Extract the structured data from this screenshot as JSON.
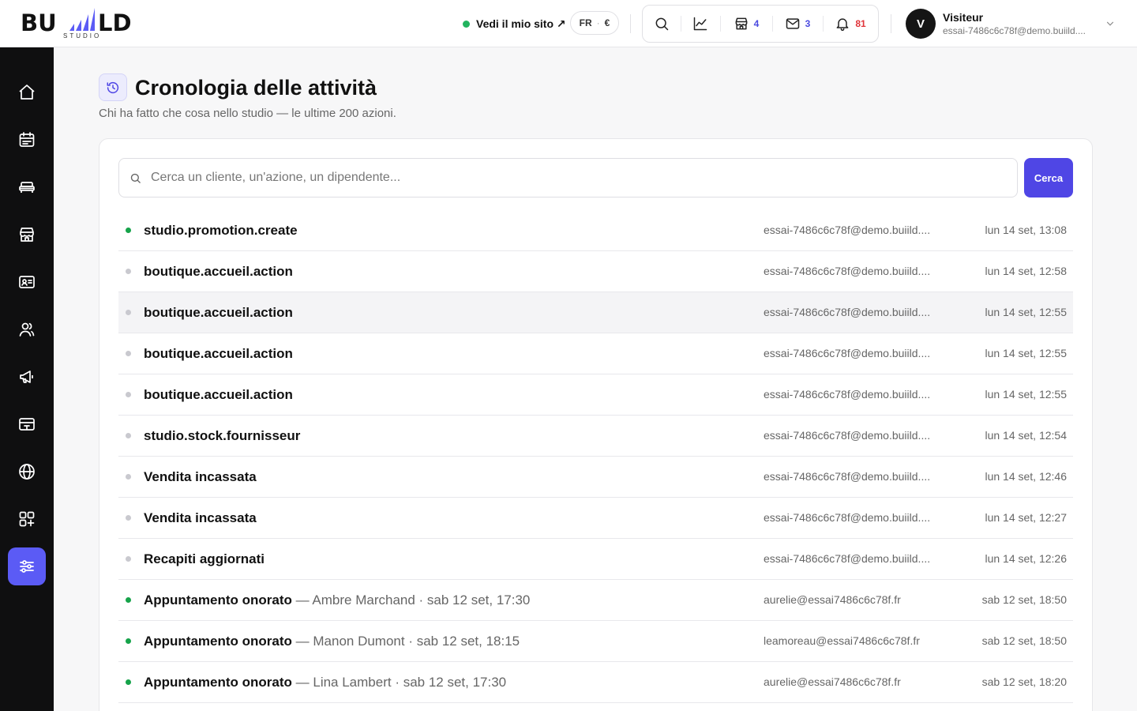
{
  "logo": {
    "word": "BU   LD",
    "sub": "STUDIO"
  },
  "header": {
    "site_link": "Vedi il mio sito ↗",
    "lang": "FR",
    "currency": "€",
    "badges": {
      "store": "4",
      "mail": "3",
      "bell": "81"
    },
    "user": {
      "initial": "V",
      "name": "Visiteur",
      "email": "essai-7486c6c78f@demo.buiild...."
    }
  },
  "sidebar": {
    "items": [
      {
        "icon": "home-icon"
      },
      {
        "icon": "calendar-icon"
      },
      {
        "icon": "treatment-bed-icon"
      },
      {
        "icon": "store-icon"
      },
      {
        "icon": "id-card-icon"
      },
      {
        "icon": "users-icon"
      },
      {
        "icon": "megaphone-icon"
      },
      {
        "icon": "register-icon"
      },
      {
        "icon": "globe-icon"
      },
      {
        "icon": "apps-add-icon"
      },
      {
        "icon": "settings-sliders-icon",
        "active": true
      }
    ]
  },
  "page": {
    "title": "Cronologia delle attività",
    "subtitle": "Chi ha fatto che cosa nello studio — le ultime 200 azioni."
  },
  "search": {
    "placeholder": "Cerca un cliente, un'azione, un dipendente...",
    "button": "Cerca"
  },
  "colors": {
    "accent": "#5b5bf5",
    "button": "#4f46e5",
    "green": "#16a34a"
  },
  "activities": [
    {
      "action": "studio.promotion.create",
      "detail": "",
      "who": "essai-7486c6c78f@demo.buiild....",
      "when": "lun 14 set, 13:08",
      "status": "green"
    },
    {
      "action": "boutique.accueil.action",
      "detail": "",
      "who": "essai-7486c6c78f@demo.buiild....",
      "when": "lun 14 set, 12:58",
      "status": "grey"
    },
    {
      "action": "boutique.accueil.action",
      "detail": "",
      "who": "essai-7486c6c78f@demo.buiild....",
      "when": "lun 14 set, 12:55",
      "status": "grey",
      "highlight": true
    },
    {
      "action": "boutique.accueil.action",
      "detail": "",
      "who": "essai-7486c6c78f@demo.buiild....",
      "when": "lun 14 set, 12:55",
      "status": "grey"
    },
    {
      "action": "boutique.accueil.action",
      "detail": "",
      "who": "essai-7486c6c78f@demo.buiild....",
      "when": "lun 14 set, 12:55",
      "status": "grey"
    },
    {
      "action": "studio.stock.fournisseur",
      "detail": "",
      "who": "essai-7486c6c78f@demo.buiild....",
      "when": "lun 14 set, 12:54",
      "status": "grey"
    },
    {
      "action": "Vendita incassata",
      "detail": "",
      "who": "essai-7486c6c78f@demo.buiild....",
      "when": "lun 14 set, 12:46",
      "status": "grey"
    },
    {
      "action": "Vendita incassata",
      "detail": "",
      "who": "essai-7486c6c78f@demo.buiild....",
      "when": "lun 14 set, 12:27",
      "status": "grey"
    },
    {
      "action": "Recapiti aggiornati",
      "detail": "",
      "who": "essai-7486c6c78f@demo.buiild....",
      "when": "lun 14 set, 12:26",
      "status": "grey"
    },
    {
      "action": "Appuntamento onorato",
      "detail": " — Ambre Marchand · sab 12 set, 17:30",
      "who": "aurelie@essai7486c6c78f.fr",
      "when": "sab 12 set, 18:50",
      "status": "green"
    },
    {
      "action": "Appuntamento onorato",
      "detail": " — Manon Dumont · sab 12 set, 18:15",
      "who": "leamoreau@essai7486c6c78f.fr",
      "when": "sab 12 set, 18:50",
      "status": "green"
    },
    {
      "action": "Appuntamento onorato",
      "detail": " — Lina Lambert · sab 12 set, 17:30",
      "who": "aurelie@essai7486c6c78f.fr",
      "when": "sab 12 set, 18:20",
      "status": "green"
    }
  ]
}
